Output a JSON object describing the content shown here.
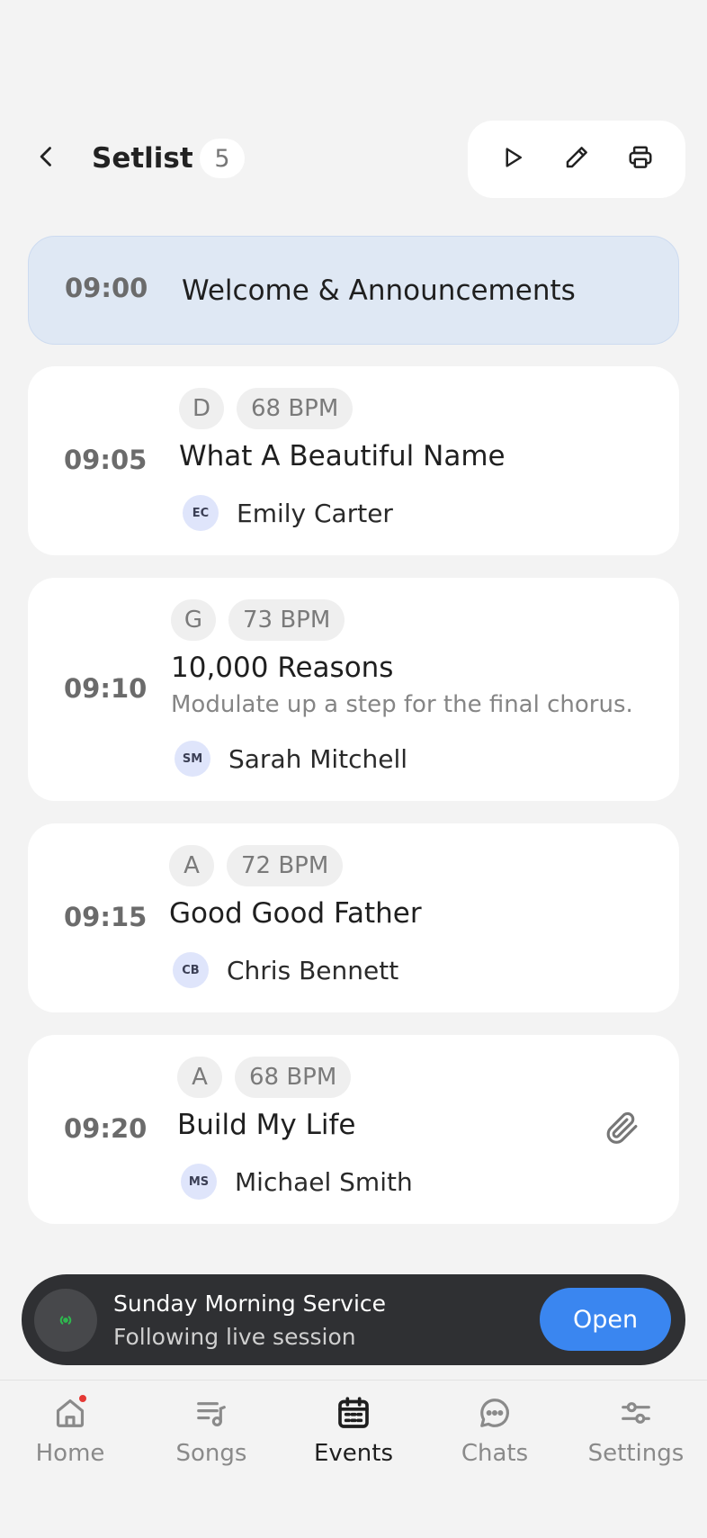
{
  "header": {
    "title": "Setlist",
    "count": "5",
    "back_icon": "chevron-left-icon",
    "toolbar": [
      "play-icon",
      "pencil-icon",
      "printer-icon"
    ]
  },
  "setlist": {
    "section": {
      "time": "09:00",
      "title": "Welcome & Announcements"
    },
    "songs": [
      {
        "time": "09:05",
        "key": "D",
        "bpm": "68 BPM",
        "title": "What A Beautiful Name",
        "note": "",
        "initials": "EC",
        "person": "Emily Carter",
        "attachment": false
      },
      {
        "time": "09:10",
        "key": "G",
        "bpm": "73 BPM",
        "title": "10,000 Reasons",
        "note": "Modulate up a step for the final chorus.",
        "initials": "SM",
        "person": "Sarah Mitchell",
        "attachment": false
      },
      {
        "time": "09:15",
        "key": "A",
        "bpm": "72 BPM",
        "title": "Good Good Father",
        "note": "",
        "initials": "CB",
        "person": "Chris Bennett",
        "attachment": false
      },
      {
        "time": "09:20",
        "key": "A",
        "bpm": "68 BPM",
        "title": "Build My Life",
        "note": "",
        "initials": "MS",
        "person": "Michael Smith",
        "attachment": true
      }
    ]
  },
  "live_session": {
    "title": "Sunday Morning Service",
    "subtitle": "Following live session",
    "open_label": "Open",
    "icon": "live-broadcast-icon"
  },
  "nav": {
    "items": [
      {
        "label": "Home",
        "icon": "home-icon",
        "active": false,
        "badge": true
      },
      {
        "label": "Songs",
        "icon": "music-list-icon",
        "active": false,
        "badge": false
      },
      {
        "label": "Events",
        "icon": "calendar-icon",
        "active": true,
        "badge": false
      },
      {
        "label": "Chats",
        "icon": "chat-bubble-icon",
        "active": false,
        "badge": false
      },
      {
        "label": "Settings",
        "icon": "sliders-icon",
        "active": false,
        "badge": false
      }
    ]
  },
  "colors": {
    "accent": "#3a86f0",
    "section_bg": "#dfe8f4",
    "banner_bg": "#2f3033",
    "notification": "#e53935"
  }
}
